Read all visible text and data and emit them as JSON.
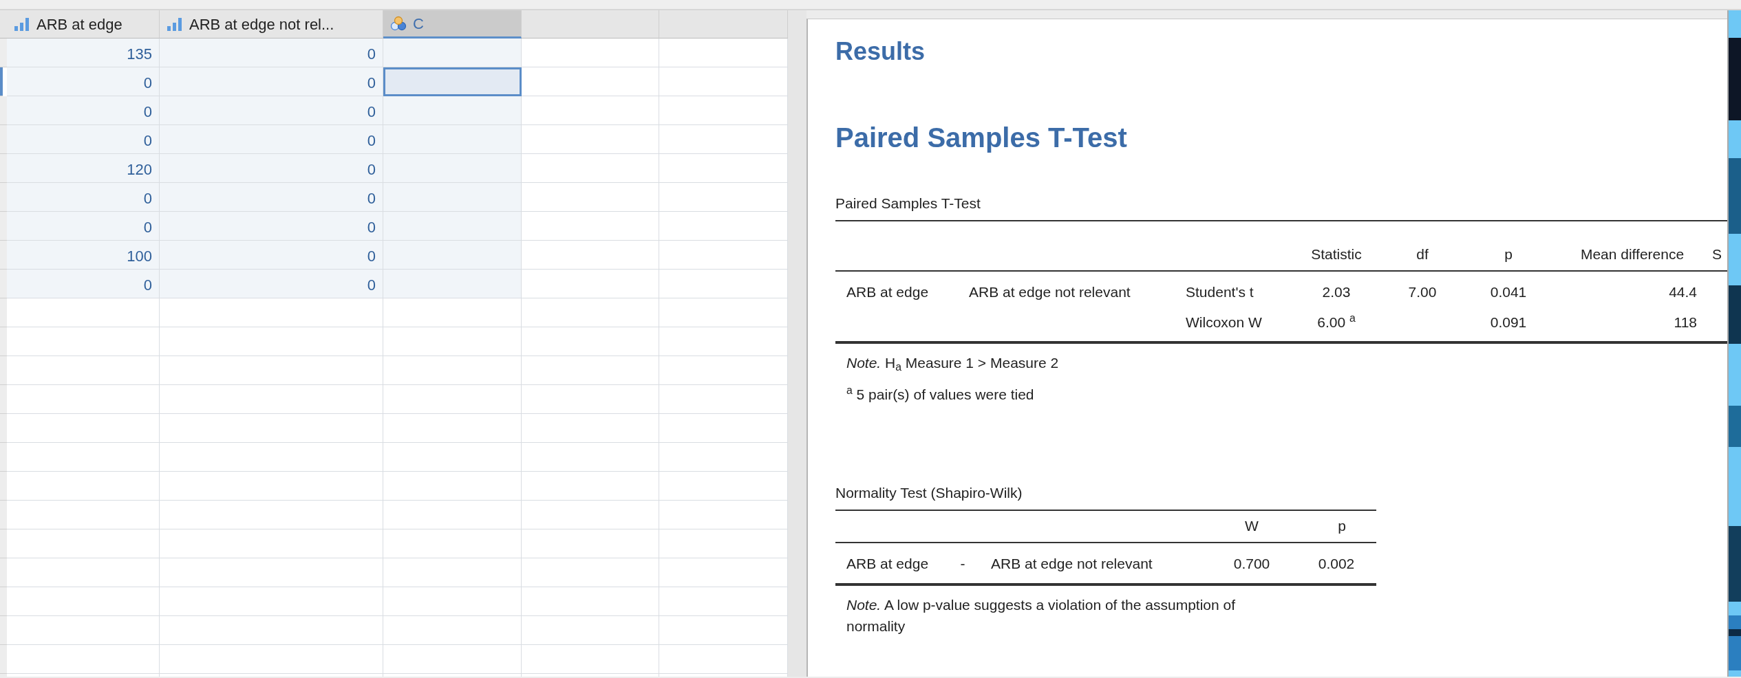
{
  "spreadsheet": {
    "columns": [
      {
        "name": "ARB at edge",
        "kind": "scale",
        "selected": false
      },
      {
        "name": "ARB at edge not rel...",
        "kind": "scale",
        "selected": false
      },
      {
        "name": "C",
        "kind": "nominal",
        "selected": true
      }
    ],
    "rows": [
      {
        "cells": [
          "135",
          "0"
        ],
        "selected": false
      },
      {
        "cells": [
          "0",
          "0"
        ],
        "selected": true
      },
      {
        "cells": [
          "0",
          "0"
        ],
        "selected": false
      },
      {
        "cells": [
          "0",
          "0"
        ],
        "selected": false
      },
      {
        "cells": [
          "120",
          "0"
        ],
        "selected": false
      },
      {
        "cells": [
          "0",
          "0"
        ],
        "selected": false
      },
      {
        "cells": [
          "0",
          "0"
        ],
        "selected": false
      },
      {
        "cells": [
          "100",
          "0"
        ],
        "selected": false
      },
      {
        "cells": [
          "0",
          "0"
        ],
        "selected": false
      }
    ]
  },
  "results": {
    "title": "Results",
    "ttest": {
      "heading": "Paired Samples T-Test",
      "table_title": "Paired Samples T-Test",
      "columns": [
        "Statistic",
        "df",
        "p",
        "Mean difference",
        "S"
      ],
      "rows": [
        {
          "measure_1": "ARB at edge",
          "measure_2": "ARB at edge not relevant",
          "test": "Student's t",
          "statistic": "2.03",
          "df": "7.00",
          "p": "0.041",
          "mean_difference": "44.4"
        },
        {
          "test": "Wilcoxon W",
          "statistic": "6.00 $^{a}$",
          "p": "0.091",
          "mean_difference": "118"
        }
      ],
      "notes": [
        "*Note.* H$_{a}$ Measure 1 > Measure 2",
        "$^{a}$ 5 pair(s) of values were tied"
      ]
    },
    "normality": {
      "table_title": "Normality Test (Shapiro-Wilk)",
      "columns": [
        "W",
        "p"
      ],
      "rows": [
        {
          "measure_1": "ARB at edge",
          "separator": "-",
          "measure_2": "ARB at edge not relevant",
          "w": "0.700",
          "p": "0.002"
        }
      ],
      "notes": [
        "*Note.* A low p-value suggests a violation of the assumption of normality"
      ]
    }
  }
}
